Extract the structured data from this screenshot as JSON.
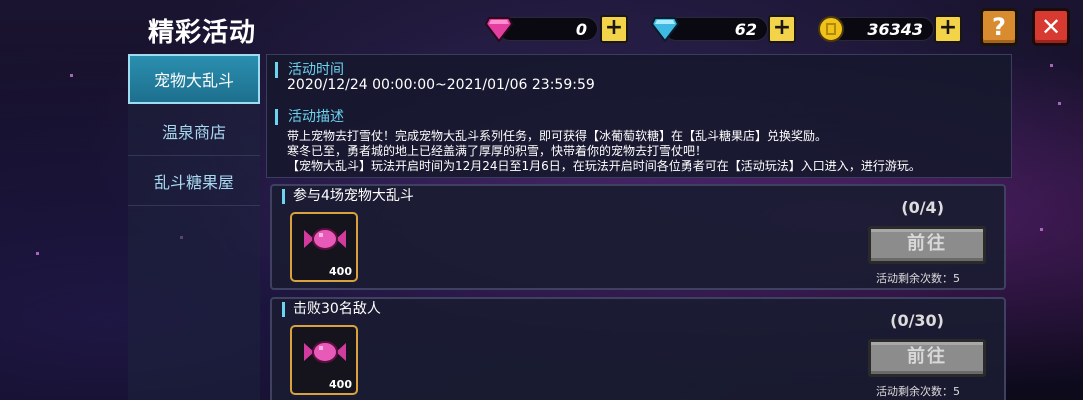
{
  "header": {
    "title": "精彩活动"
  },
  "currencies": [
    {
      "name": "pink-gem",
      "value": "0"
    },
    {
      "name": "blue-gem",
      "value": "62"
    },
    {
      "name": "gold-coin",
      "value": "36343"
    }
  ],
  "buttons": {
    "plus": "+",
    "help": "?",
    "close": "✕"
  },
  "sidebar": {
    "items": [
      {
        "label": "宠物大乱斗",
        "active": true
      },
      {
        "label": "温泉商店",
        "active": false
      },
      {
        "label": "乱斗糖果屋",
        "active": false
      }
    ]
  },
  "info": {
    "time_heading": "活动时间",
    "time_value": "2020/12/24 00:00:00~2021/01/06 23:59:59",
    "desc_heading": "活动描述",
    "desc_lines": [
      "带上宠物去打雪仗！完成宠物大乱斗系列任务，即可获得【冰葡萄软糖】在【乱斗糖果店】兑换奖励。",
      "寒冬已至，勇者城的地上已经盖满了厚厚的积雪，快带着你的宠物去打雪仗吧！",
      "【宠物大乱斗】玩法开启时间为12月24日至1月6日，在玩法开启时间各位勇者可在【活动玩法】入口进入，进行游玩。"
    ]
  },
  "tasks": [
    {
      "title": "参与4场宠物大乱斗",
      "reward_qty": "400",
      "reward_icon": "candy-icon",
      "progress": "(0/4)",
      "button": "前往",
      "remaining": "活动剩余次数：5"
    },
    {
      "title": "击败30名敌人",
      "reward_qty": "400",
      "reward_icon": "candy-icon",
      "progress": "(0/30)",
      "button": "前往",
      "remaining": "活动剩余次数：5"
    }
  ],
  "colors": {
    "accent": "#6cd3f0",
    "active_tab": "#2b8fb0",
    "reward_border": "#d9a23c",
    "plus_button": "#f2d34a",
    "close_button": "#d63a30",
    "help_button": "#d98b2f"
  }
}
